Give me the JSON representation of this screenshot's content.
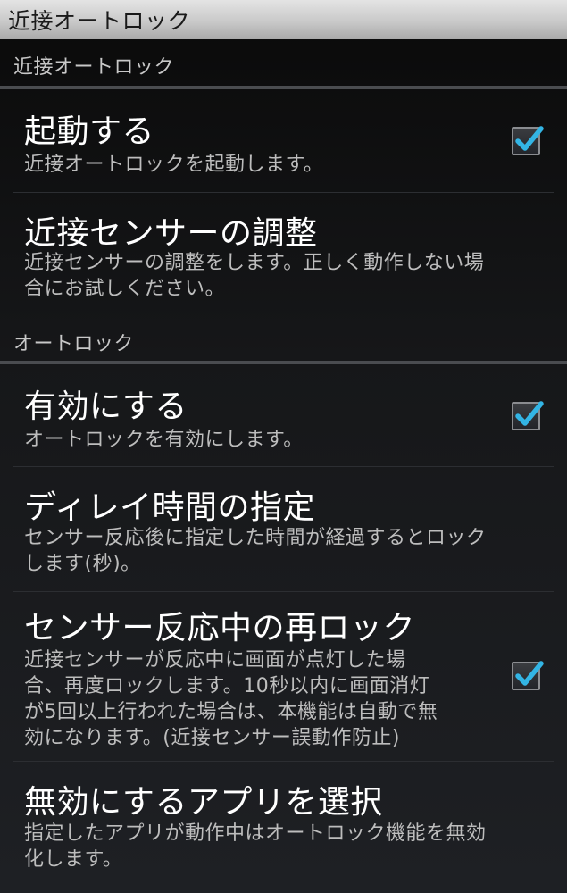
{
  "titlebar": {
    "title": "近接オートロック"
  },
  "sections": [
    {
      "header": "近接オートロック",
      "items": [
        {
          "title": "起動する",
          "summary_lines": [
            "近接オートロックを起動します。"
          ],
          "checkbox": true,
          "checked": true
        },
        {
          "title": "近接センサーの調整",
          "summary_lines": [
            "近接センサーの調整をします。正しく動作しない場",
            "合にお試しください。"
          ],
          "checkbox": false
        }
      ]
    },
    {
      "header": "オートロック",
      "items": [
        {
          "title": "有効にする",
          "summary_lines": [
            "オートロックを有効にします。"
          ],
          "checkbox": true,
          "checked": true
        },
        {
          "title": "ディレイ時間の指定",
          "summary_lines": [
            "センサー反応後に指定した時間が経過するとロック",
            "します(秒)。"
          ],
          "checkbox": false
        },
        {
          "title": "センサー反応中の再ロック",
          "summary_lines": [
            "近接センサーが反応中に画面が点灯した場",
            "合、再度ロックします。10秒以内に画面消灯",
            "が5回以上行われた場合は、本機能は自動で無",
            "効になります。(近接センサー誤動作防止)"
          ],
          "checkbox": true,
          "checked": true
        },
        {
          "title": "無効にするアプリを選択",
          "summary_lines": [
            "指定したアプリが動作中はオートロック機能を無効",
            "化します。"
          ],
          "checkbox": false
        }
      ]
    }
  ],
  "colors": {
    "check_accent": "#33b5e5",
    "category_line": "#4a4c50",
    "titlebar_bg": "#c9c9c9"
  }
}
